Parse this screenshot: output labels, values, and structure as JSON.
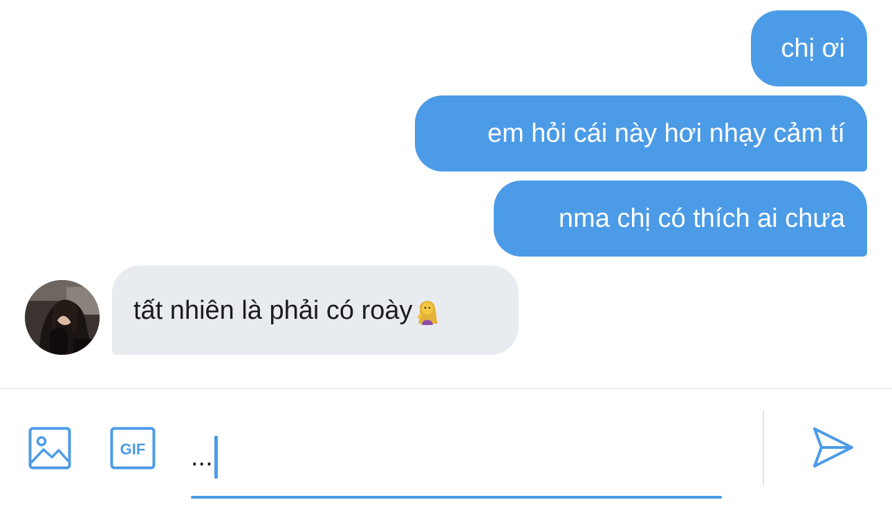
{
  "conversation": {
    "messages": [
      {
        "direction": "outgoing",
        "text": "chị ơi"
      },
      {
        "direction": "outgoing",
        "text": "em hỏi cái này hơi nhạy cảm tí"
      },
      {
        "direction": "outgoing",
        "text": "nma chị có thích ai chưa"
      },
      {
        "direction": "incoming",
        "text": "tất nhiên là phải có roày",
        "emoji": "woman-tipping-hand"
      }
    ]
  },
  "composer": {
    "image_icon": "image-icon",
    "gif_label": "GIF",
    "input_value": "...",
    "send_icon": "send-icon"
  },
  "colors": {
    "accent": "#4c9be6",
    "incoming_bubble": "#e8ebef",
    "outgoing_text": "#ffffff",
    "incoming_text": "#1c1c1e"
  }
}
